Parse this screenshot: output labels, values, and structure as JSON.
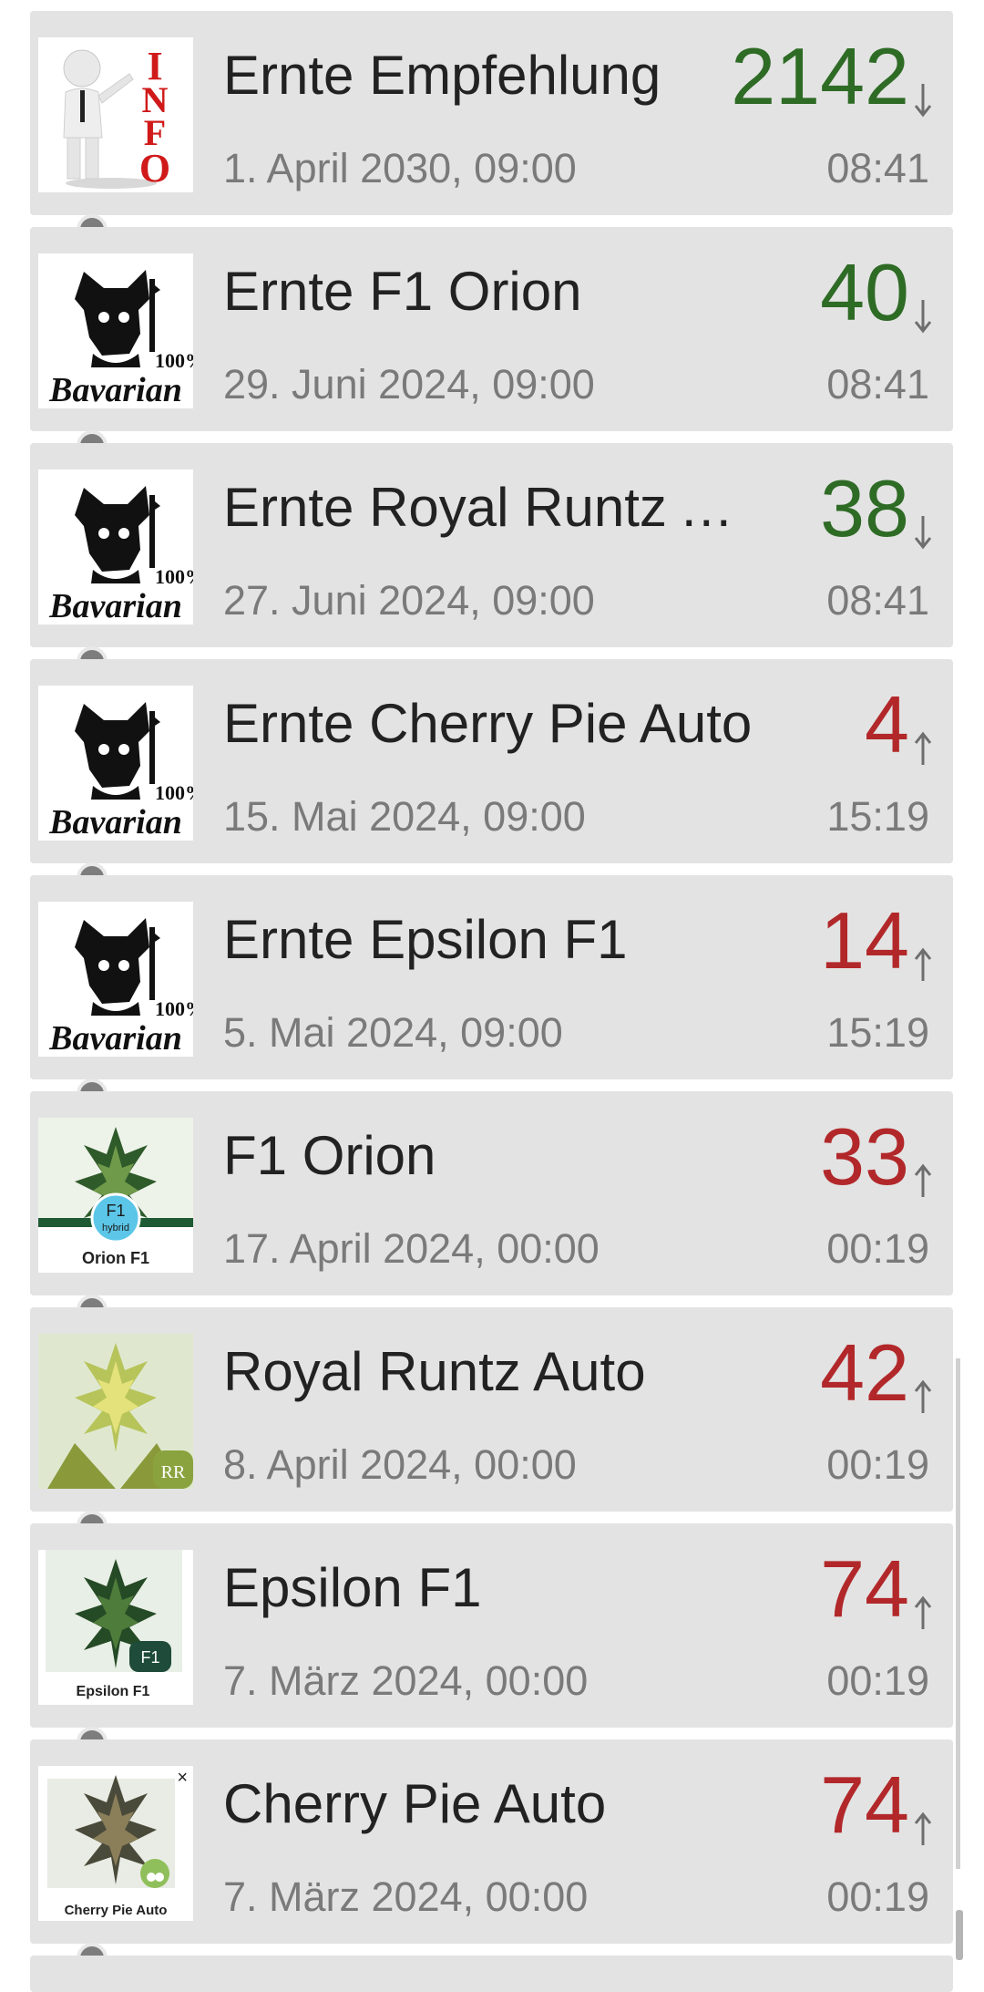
{
  "items": [
    {
      "title": "Ernte Empfehlung",
      "date": "1. April 2030, 09:00",
      "count": "2142",
      "trend": "down",
      "time": "08:41",
      "thumb": "info-figure"
    },
    {
      "title": "Ernte F1 Orion",
      "date": "29. Juni 2024, 09:00",
      "count": "40",
      "trend": "down",
      "time": "08:41",
      "thumb": "bavarian-logo"
    },
    {
      "title": "Ernte Royal Runtz A...",
      "date": "27. Juni 2024, 09:00",
      "count": "38",
      "trend": "down",
      "time": "08:41",
      "thumb": "bavarian-logo"
    },
    {
      "title": "Ernte Cherry Pie Auto",
      "date": "15. Mai 2024, 09:00",
      "count": "4",
      "trend": "up",
      "time": "15:19",
      "thumb": "bavarian-logo"
    },
    {
      "title": "Ernte Epsilon F1",
      "date": "5. Mai 2024, 09:00",
      "count": "14",
      "trend": "up",
      "time": "15:19",
      "thumb": "bavarian-logo"
    },
    {
      "title": "F1 Orion",
      "date": "17. April 2024, 00:00",
      "count": "33",
      "trend": "up",
      "time": "00:19",
      "thumb": "plant-orion"
    },
    {
      "title": "Royal Runtz Auto",
      "date": "8. April 2024, 00:00",
      "count": "42",
      "trend": "up",
      "time": "00:19",
      "thumb": "plant-runtz"
    },
    {
      "title": "Epsilon F1",
      "date": "7. März 2024, 00:00",
      "count": "74",
      "trend": "up",
      "time": "00:19",
      "thumb": "plant-epsilon"
    },
    {
      "title": "Cherry Pie Auto",
      "date": "7. März 2024, 00:00",
      "count": "74",
      "trend": "up",
      "time": "00:19",
      "thumb": "plant-cherry"
    }
  ],
  "thumb_text": {
    "info": "INFO",
    "bavarian_percent": "100%",
    "bavarian_name": "Bavarian",
    "orion_badge": "F1",
    "orion_badge_sub": "hybrid",
    "orion_caption": "Orion F1",
    "runtz_badge": "RR",
    "epsilon_badge": "F1",
    "epsilon_caption": "Epsilon F1",
    "cherry_caption": "Cherry Pie Auto",
    "cherry_close": "×"
  },
  "colors": {
    "down": "#2e6b25",
    "up": "#b2282a",
    "card": "#e3e3e3"
  }
}
